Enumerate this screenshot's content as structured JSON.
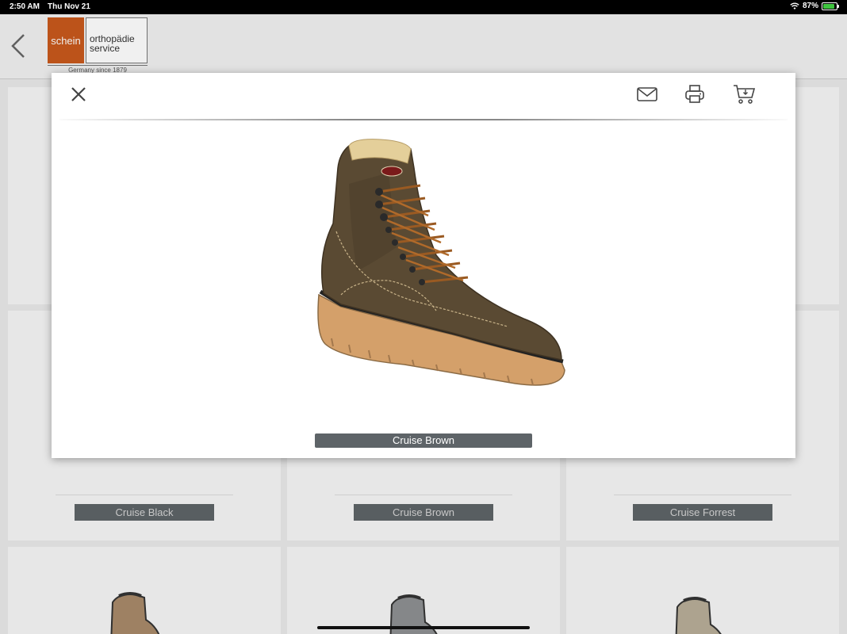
{
  "status_bar": {
    "time": "2:50 AM",
    "date": "Thu Nov 21",
    "battery": "87%",
    "battery_fraction": 0.87
  },
  "header": {
    "logo": {
      "brand": "schein",
      "name_line1": "orthopädie",
      "name_line2": "service",
      "tagline": "Germany since 1879"
    }
  },
  "grid": {
    "items": [
      {
        "label": "Cruise Black"
      },
      {
        "label": "Cruise Brown"
      },
      {
        "label": "Cruise Forrest"
      }
    ]
  },
  "modal": {
    "product_name": "Cruise Brown",
    "icons": {
      "close": "close-icon",
      "mail": "mail-icon",
      "print": "printer-icon",
      "cart": "cart-icon"
    }
  },
  "colors": {
    "accent_orange": "#c8591c",
    "label_gray": "#5e6468",
    "boot_brown": "#5a4a33"
  }
}
